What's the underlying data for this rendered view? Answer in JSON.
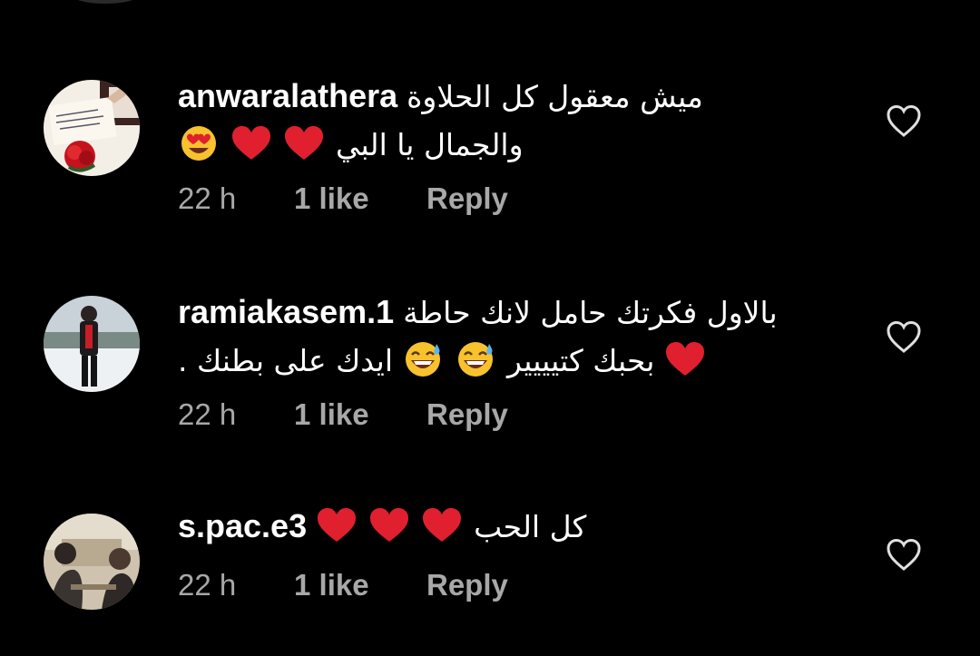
{
  "comments": [
    {
      "username": "anwaralathera",
      "text_line1": "ميش معقول كل الحلاوة",
      "text_line2": "والجمال يا البي",
      "emojis_line2": [
        "heart-eyes",
        "heart",
        "heart"
      ],
      "time": "22 h",
      "likes": "1 like",
      "reply": "Reply"
    },
    {
      "username": "ramiakasem.1",
      "text_line1": "بالاول فكرتك حامل لانك حاطة",
      "text_line2_a": "ايدك على بطنك",
      "text_line2_b": ". بحبك كتيييير",
      "emojis_line2": [
        "heart",
        "sweat-smile",
        "sweat-smile"
      ],
      "time": "22 h",
      "likes": "1 like",
      "reply": "Reply"
    },
    {
      "username": "s.pac.e3",
      "text_line1": "كل الحب",
      "emojis_line1": [
        "heart",
        "heart",
        "heart"
      ],
      "time": "22 h",
      "likes": "1 like",
      "reply": "Reply"
    }
  ],
  "colors": {
    "background": "#000000",
    "text": "#ffffff",
    "meta": "#a8a8a8",
    "heart_emoji": "#e0202f",
    "like_icon": "#e0e0e0"
  },
  "icons": {
    "like": "heart-outline-icon"
  }
}
